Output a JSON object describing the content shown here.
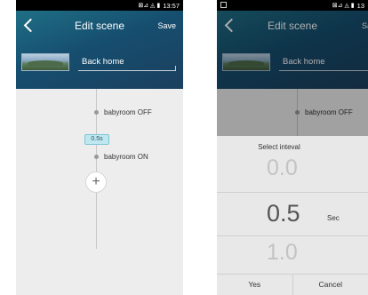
{
  "left": {
    "status": {
      "signal_icons": "⊠⊿ ◬ ▮",
      "time": "13:57"
    },
    "header": {
      "title": "Edit scene",
      "save_label": "Save",
      "scene_name": "Back home"
    },
    "steps": [
      {
        "label": "babyroom OFF"
      },
      {
        "label": "babyroom ON"
      }
    ],
    "delay": "0.5s",
    "add_symbol": "+"
  },
  "right": {
    "status": {
      "signal_icons": "⊠⊿ ◬ ▮",
      "time": "13"
    },
    "header": {
      "title": "Edit scene",
      "save_label": "Sa",
      "scene_name": "Back home"
    },
    "steps": [
      {
        "label": "babyroom OFF"
      }
    ],
    "dialog": {
      "title": "Select inteval",
      "values": [
        "0.0",
        "0.5",
        "1.0"
      ],
      "selected": "0.5",
      "unit": "Sec",
      "yes_label": "Yes",
      "cancel_label": "Cancel"
    }
  },
  "colors": {
    "header": "#1c5a78",
    "accent": "#bfe7ef",
    "background": "#ededed"
  },
  "icons": {
    "back": "chevron-left-icon",
    "add": "plus-icon",
    "scene_thumb": "landscape-image"
  }
}
